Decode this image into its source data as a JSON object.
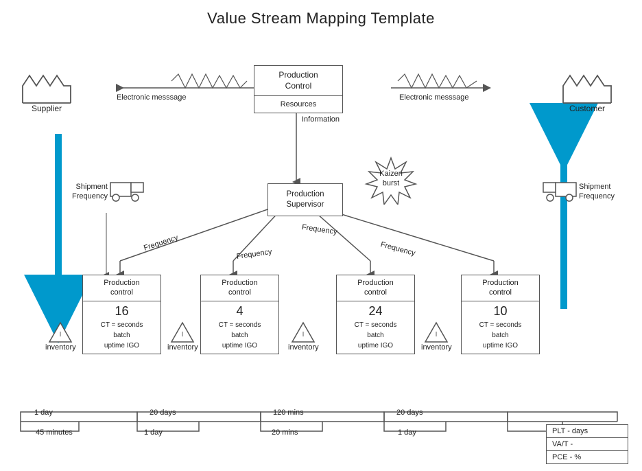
{
  "title": "Value Stream Mapping Template",
  "supplier": {
    "label": "Supplier"
  },
  "customer": {
    "label": "Customer"
  },
  "productionControl": {
    "label": "Production\nControl",
    "sublabel": "Resources"
  },
  "electronicMsg1": "Electronic messsage",
  "electronicMsg2": "Electronic messsage",
  "information": "Information",
  "productionSupervisor": {
    "label": "Production\nSupervisor"
  },
  "kaizen": {
    "label": "Kaizen\nburst"
  },
  "trucks": [
    {
      "id": "truck-left",
      "label": "Shipment\nFrequency"
    },
    {
      "id": "truck-right",
      "label": "Shipment\nFrequency"
    }
  ],
  "frequencies": [
    "Frequency",
    "Frequency",
    "Frequency",
    "Frequency"
  ],
  "processes": [
    {
      "id": "proc1",
      "title": "Production\ncontrol",
      "number": "16",
      "details": "CT = seconds\nbatch\nuptime IGO"
    },
    {
      "id": "proc2",
      "title": "Production\ncontrol",
      "number": "4",
      "details": "CT = seconds\nbatch\nuptime IGO"
    },
    {
      "id": "proc3",
      "title": "Production\ncontrol",
      "number": "24",
      "details": "CT = seconds\nbatch\nuptime IGO"
    },
    {
      "id": "proc4",
      "title": "Production\ncontrol",
      "number": "10",
      "details": "CT = seconds\nbatch\nuptime IGO"
    }
  ],
  "inventories": [
    "inventory",
    "inventory",
    "inventory",
    "inventory"
  ],
  "timeline": {
    "top": [
      "1 day",
      "20 days",
      "120 mins",
      "20 days"
    ],
    "bottom": [
      "45 minutes",
      "1 day",
      "20 mins",
      "1 day"
    ]
  },
  "legend": [
    {
      "label": "PLT - days"
    },
    {
      "label": "VA/T -"
    },
    {
      "label": "PCE - %"
    }
  ],
  "colors": {
    "arrow_blue": "#0099cc",
    "line": "#555"
  }
}
